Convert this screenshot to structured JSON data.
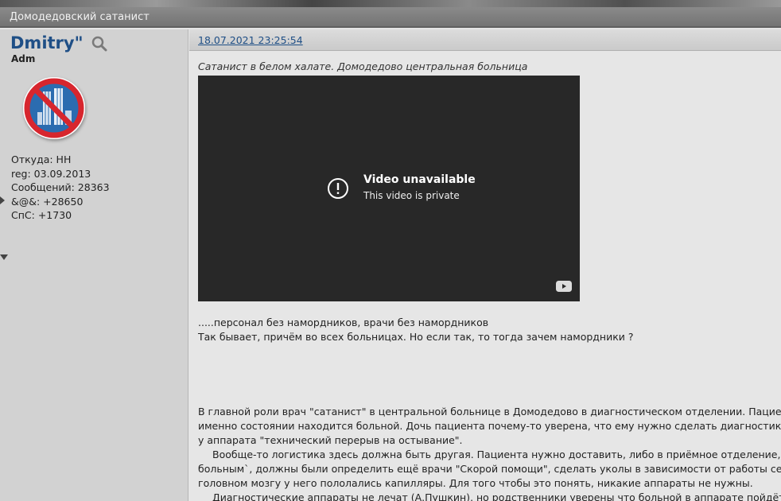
{
  "thread": {
    "title": "Домодедовский сатанист"
  },
  "author": {
    "name": "Dmitry\"",
    "role": "Adm",
    "stats": [
      "Откуда: НН",
      "reg: 03.09.2013",
      "Сообщений: 28363",
      "&@&: +28650",
      "СпС: +1730"
    ]
  },
  "post": {
    "date": "18.07.2021 23:25:54",
    "caption": "Сатанист в белом халате. Домодедово центральная больница",
    "video": {
      "title": "Video unavailable",
      "subtitle": "This video is private"
    },
    "lines_a": [
      ".....персонал без намордников, врачи без намордников",
      "Так бывает, причём во всех больницах. Но если так, то тогда зачем намордники ?"
    ],
    "lines_b": [
      "В главной роли врач \"сатанист\" в центральной больнице в Домодедово в диагностическом отделении. Пациент н",
      "именно состоянии находится больной. Дочь пациента почему-то уверена, что ему нужно сделать диагностику на",
      "у аппарата \"технический перерыв на остывание\"."
    ],
    "lines_c": [
      "Вообще-то логистика здесь должна быть другая. Пациента нужно доставить, либо в приёмное отделение, либ",
      "больным`, должны были определить ещё врачи \"Скорой помощи\", сделать уколы в зависимости от работы серд",
      "головном мозгу у него пололались капилляры. Для того чтобы это понять, никакие аппараты не нужны.",
      "Диагностические аппараты не лечат (А.Пушкин), но родственники уверены что больной в аппарате пойдёт на"
    ]
  },
  "colors": {
    "link": "#1f4f86",
    "video_bg": "#282828",
    "sidebar_bg": "#d2d2d2"
  }
}
